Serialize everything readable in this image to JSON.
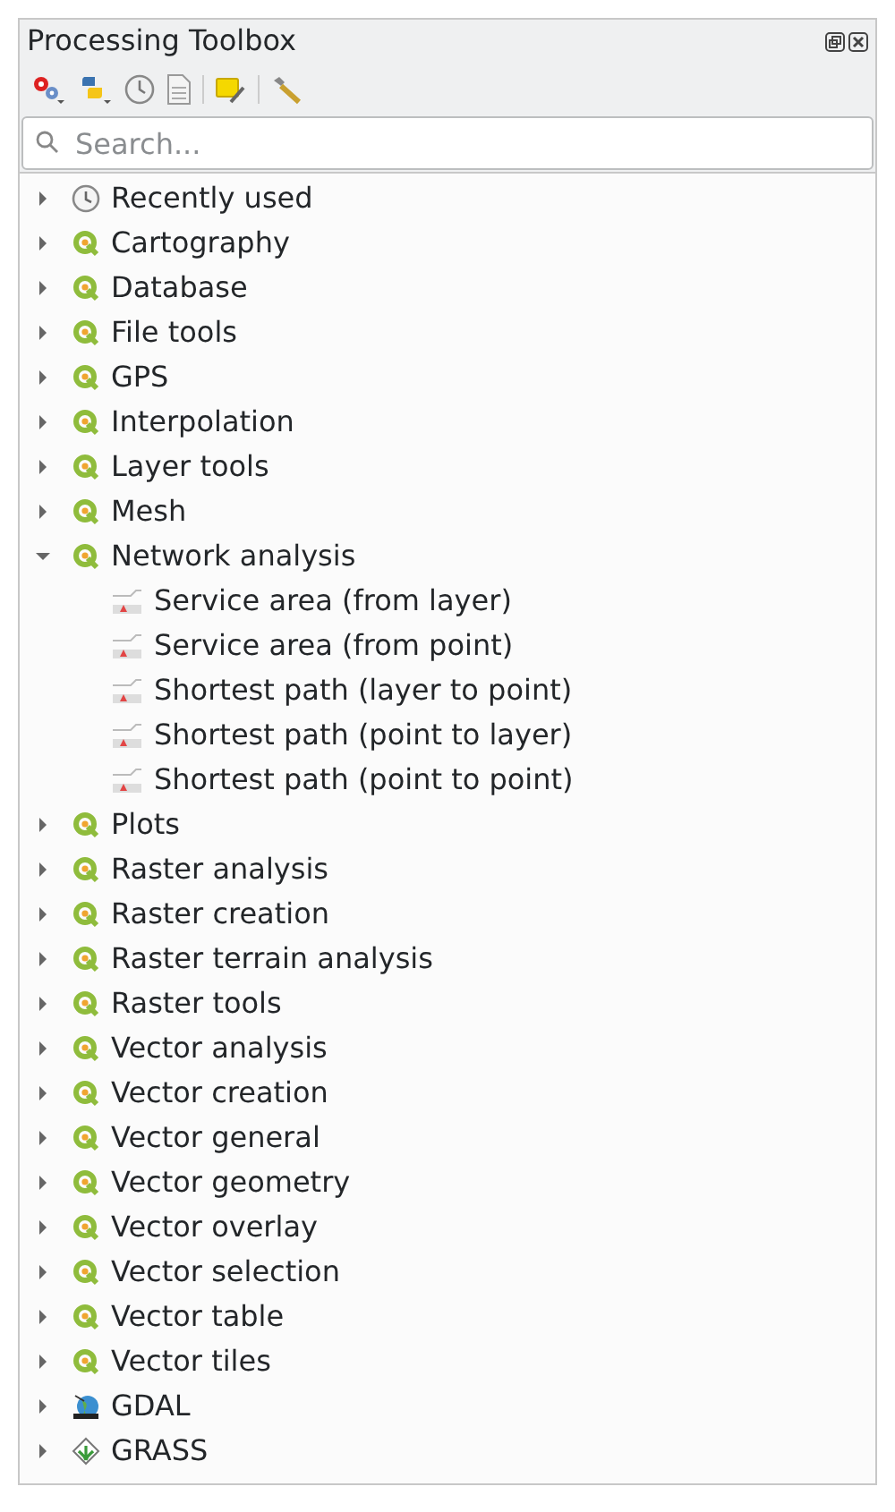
{
  "panel": {
    "title": "Processing Toolbox"
  },
  "search": {
    "placeholder": "Search..."
  },
  "tree": [
    {
      "label": "Recently used",
      "kind": "history",
      "expanded": false
    },
    {
      "label": "Cartography",
      "kind": "qgis",
      "expanded": false
    },
    {
      "label": "Database",
      "kind": "qgis",
      "expanded": false
    },
    {
      "label": "File tools",
      "kind": "qgis",
      "expanded": false
    },
    {
      "label": "GPS",
      "kind": "qgis",
      "expanded": false
    },
    {
      "label": "Interpolation",
      "kind": "qgis",
      "expanded": false
    },
    {
      "label": "Layer tools",
      "kind": "qgis",
      "expanded": false
    },
    {
      "label": "Mesh",
      "kind": "qgis",
      "expanded": false
    },
    {
      "label": "Network analysis",
      "kind": "qgis",
      "expanded": true,
      "children": [
        {
          "label": "Service area (from layer)",
          "kind": "algorithm"
        },
        {
          "label": "Service area (from point)",
          "kind": "algorithm"
        },
        {
          "label": "Shortest path (layer to point)",
          "kind": "algorithm"
        },
        {
          "label": "Shortest path (point to layer)",
          "kind": "algorithm"
        },
        {
          "label": "Shortest path (point to point)",
          "kind": "algorithm"
        }
      ]
    },
    {
      "label": "Plots",
      "kind": "qgis",
      "expanded": false
    },
    {
      "label": "Raster analysis",
      "kind": "qgis",
      "expanded": false
    },
    {
      "label": "Raster creation",
      "kind": "qgis",
      "expanded": false
    },
    {
      "label": "Raster terrain analysis",
      "kind": "qgis",
      "expanded": false
    },
    {
      "label": "Raster tools",
      "kind": "qgis",
      "expanded": false
    },
    {
      "label": "Vector analysis",
      "kind": "qgis",
      "expanded": false
    },
    {
      "label": "Vector creation",
      "kind": "qgis",
      "expanded": false
    },
    {
      "label": "Vector general",
      "kind": "qgis",
      "expanded": false
    },
    {
      "label": "Vector geometry",
      "kind": "qgis",
      "expanded": false
    },
    {
      "label": "Vector overlay",
      "kind": "qgis",
      "expanded": false
    },
    {
      "label": "Vector selection",
      "kind": "qgis",
      "expanded": false
    },
    {
      "label": "Vector table",
      "kind": "qgis",
      "expanded": false
    },
    {
      "label": "Vector tiles",
      "kind": "qgis",
      "expanded": false
    },
    {
      "label": "GDAL",
      "kind": "gdal",
      "expanded": false
    },
    {
      "label": "GRASS",
      "kind": "grass",
      "expanded": false
    }
  ]
}
